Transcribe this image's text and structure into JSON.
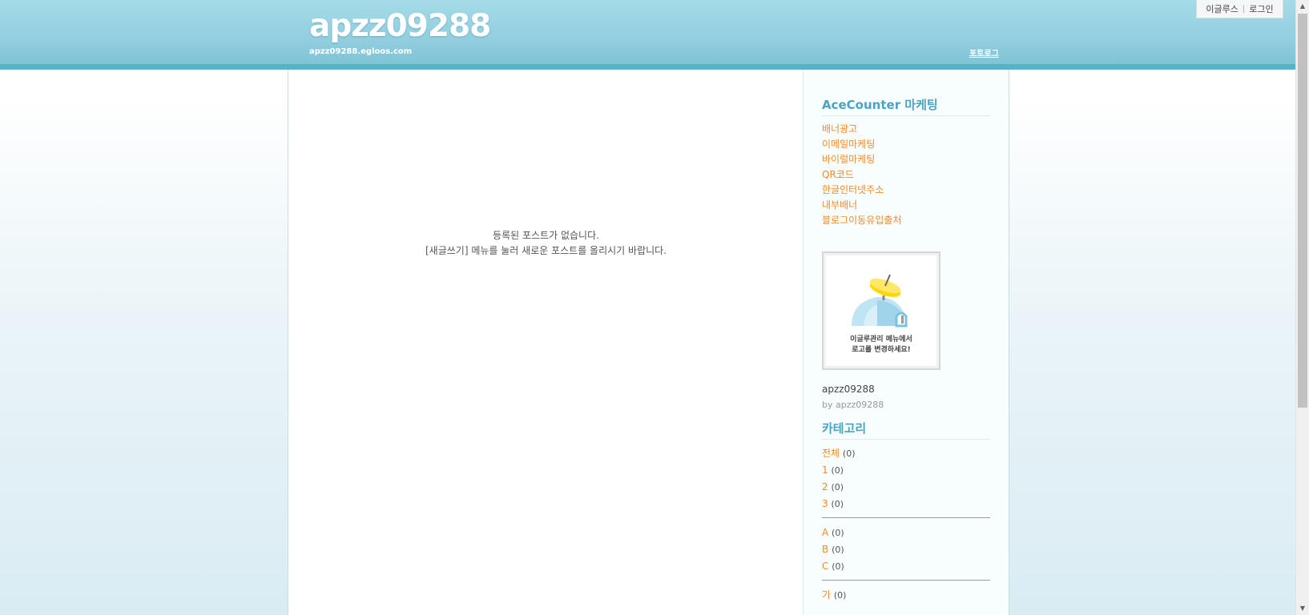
{
  "header": {
    "title": "apzz09288",
    "url": "apzz09288.egloos.com",
    "prologue": "포토로그"
  },
  "top_menu": {
    "egloos": "이글루스",
    "login": "로그인"
  },
  "main": {
    "empty_line1": "등록된 포스트가 없습니다.",
    "empty_line2": "[새글쓰기] 메뉴를 눌러 새로운 포스트를 올리시기 바랍니다."
  },
  "sidebar": {
    "acecounter": {
      "title": "AceCounter 마케팅",
      "links": [
        "배너광고",
        "이메일마케팅",
        "바이럴마케팅",
        "QR코드",
        "한글인터넷주소",
        "내부배너",
        "블로그이동유입출처"
      ]
    },
    "profile": {
      "caption_line1": "이글루관리 메뉴에서",
      "caption_line2": "로고를 변경하세요!",
      "name": "apzz09288",
      "by": "by apzz09288"
    },
    "categories": {
      "title": "카테고리",
      "group1": [
        {
          "label": "전체",
          "count": "(0)"
        },
        {
          "label": "1",
          "count": "(0)"
        },
        {
          "label": "2",
          "count": "(0)"
        },
        {
          "label": "3",
          "count": "(0)"
        }
      ],
      "group2": [
        {
          "label": "A",
          "count": "(0)"
        },
        {
          "label": "B",
          "count": "(0)"
        },
        {
          "label": "C",
          "count": "(0)"
        }
      ],
      "group3": [
        {
          "label": "가",
          "count": "(0)"
        }
      ]
    }
  },
  "colors": {
    "header_bg": "#92cfe0",
    "accent_link": "#f08a24",
    "section_title": "#4aa3c4"
  }
}
